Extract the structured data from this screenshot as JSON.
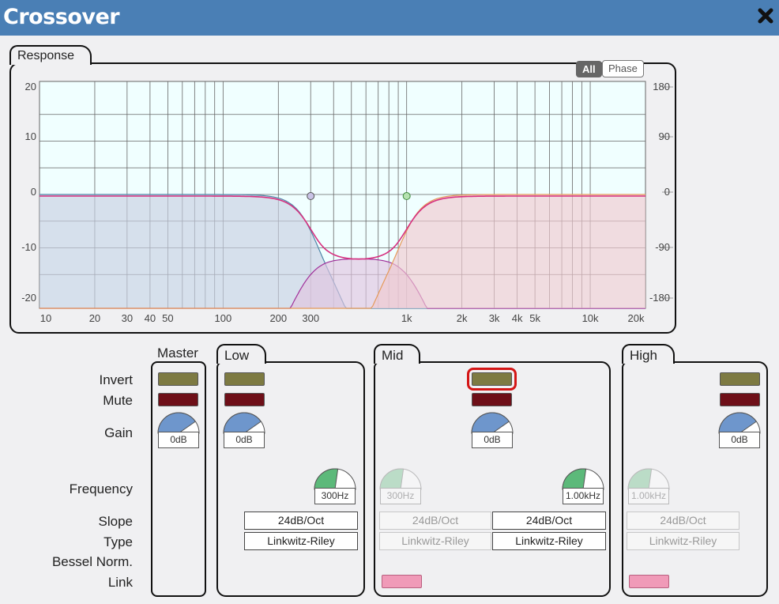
{
  "window": {
    "title": "Crossover",
    "close_icon": "close-x-icon"
  },
  "response": {
    "label": "Response",
    "buttons": {
      "all": "All",
      "phase": "Phase"
    },
    "y_ticks_left": [
      "20",
      "10",
      "0",
      "-10",
      "-20"
    ],
    "y_ticks_right": [
      "180",
      "90",
      "0",
      "-90",
      "-180"
    ],
    "x_ticks": [
      "10",
      "20",
      "30",
      "40",
      "50",
      "100",
      "200",
      "300",
      "1k",
      "2k",
      "3k",
      "4k",
      "5k",
      "10k",
      "20k"
    ]
  },
  "chart_data": {
    "type": "line",
    "x_scale": "log",
    "xlim": [
      10,
      20000
    ],
    "ylim": [
      -20,
      20
    ],
    "y2lim": [
      -180,
      180
    ],
    "x_tick_labels": [
      "10",
      "20",
      "30",
      "40",
      "50",
      "100",
      "200",
      "300",
      "1k",
      "2k",
      "3k",
      "4k",
      "5k",
      "10k",
      "20k"
    ],
    "y_tick_labels": [
      "20",
      "10",
      "0",
      "-10",
      "-20"
    ],
    "y2_tick_labels": [
      "180",
      "90",
      "0",
      "-90",
      "-180"
    ],
    "crossover_points_hz": [
      300,
      1000
    ],
    "series": [
      {
        "color": "#4f86a8",
        "fill": "#c7cfe2",
        "filter": "lowpass 300Hz 24dB/Oct"
      },
      {
        "color": "#a0309a",
        "fill": "#e0c4e0",
        "filter": "bandpass 300Hz-1kHz 24dB/Oct"
      },
      {
        "color": "#e59a5a",
        "fill": "#f0c9cf",
        "filter": "highpass 1kHz 24dB/Oct"
      },
      {
        "color": "#d6307f",
        "fill": "none",
        "filter": "sum"
      }
    ],
    "grid": true
  },
  "labels": {
    "invert": "Invert",
    "mute": "Mute",
    "gain": "Gain",
    "frequency": "Frequency",
    "slope": "Slope",
    "type": "Type",
    "bessel": "Bessel Norm.",
    "link": "Link"
  },
  "master": {
    "title": "Master",
    "gain": "0dB"
  },
  "low": {
    "title": "Low",
    "gain": "0dB",
    "frequency": "300Hz",
    "slope": "24dB/Oct",
    "type": "Linkwitz-Riley"
  },
  "mid": {
    "title": "Mid",
    "gain": "0dB",
    "freq_low": "300Hz",
    "freq_high": "1.00kHz",
    "slope_low": "24dB/Oct",
    "slope_high": "24dB/Oct",
    "type_low": "Linkwitz-Riley",
    "type_high": "Linkwitz-Riley"
  },
  "high": {
    "title": "High",
    "gain": "0dB",
    "frequency": "1.00kHz",
    "slope": "24dB/Oct",
    "type": "Linkwitz-Riley"
  },
  "colors": {
    "titlebar": "#4a7fb5",
    "invert": "#7d7a42",
    "mute": "#6e0f18",
    "link": "#f09ab8",
    "knob_active": "#6e96cc",
    "freq_active": "#5cb97a",
    "selected_outline": "#d41515"
  }
}
